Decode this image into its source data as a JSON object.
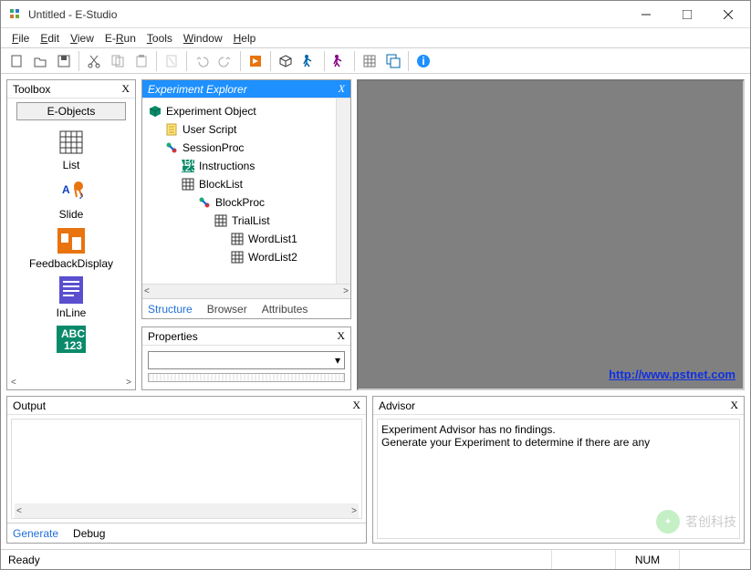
{
  "window": {
    "title": "Untitled - E-Studio"
  },
  "menu": {
    "file": "File",
    "edit": "Edit",
    "view": "View",
    "erun": "E-Run",
    "tools": "Tools",
    "window": "Window",
    "help": "Help"
  },
  "toolbox": {
    "title": "Toolbox",
    "close": "X",
    "eobjects": "E-Objects",
    "items": [
      {
        "label": "List"
      },
      {
        "label": "Slide"
      },
      {
        "label": "FeedbackDisplay"
      },
      {
        "label": "InLine"
      },
      {
        "label": ""
      }
    ],
    "abc123": "ABC\n123"
  },
  "explorer": {
    "title": "Experiment Explorer",
    "close": "X",
    "nodes": [
      {
        "label": "Experiment Object",
        "indent": 0,
        "icon": "cube"
      },
      {
        "label": "User Script",
        "indent": 1,
        "icon": "script"
      },
      {
        "label": "SessionProc",
        "indent": 1,
        "icon": "proc"
      },
      {
        "label": "Instructions",
        "indent": 2,
        "icon": "abc"
      },
      {
        "label": "BlockList",
        "indent": 2,
        "icon": "list"
      },
      {
        "label": "BlockProc",
        "indent": 3,
        "icon": "proc"
      },
      {
        "label": "TrialList",
        "indent": 4,
        "icon": "list"
      },
      {
        "label": "WordList1",
        "indent": 5,
        "icon": "list"
      },
      {
        "label": "WordList2",
        "indent": 5,
        "icon": "list"
      }
    ],
    "tabs": {
      "structure": "Structure",
      "browser": "Browser",
      "attributes": "Attributes"
    }
  },
  "properties": {
    "title": "Properties",
    "close": "X"
  },
  "preview": {
    "link": "http://www.pstnet.com"
  },
  "output": {
    "title": "Output",
    "close": "X",
    "tabs": {
      "generate": "Generate",
      "debug": "Debug"
    }
  },
  "advisor": {
    "title": "Advisor",
    "close": "X",
    "line1": "Experiment Advisor has no findings.",
    "line2": "Generate your Experiment to determine if there are any "
  },
  "status": {
    "ready": "Ready",
    "num": "NUM"
  },
  "watermark": {
    "text": "茗创科技"
  }
}
